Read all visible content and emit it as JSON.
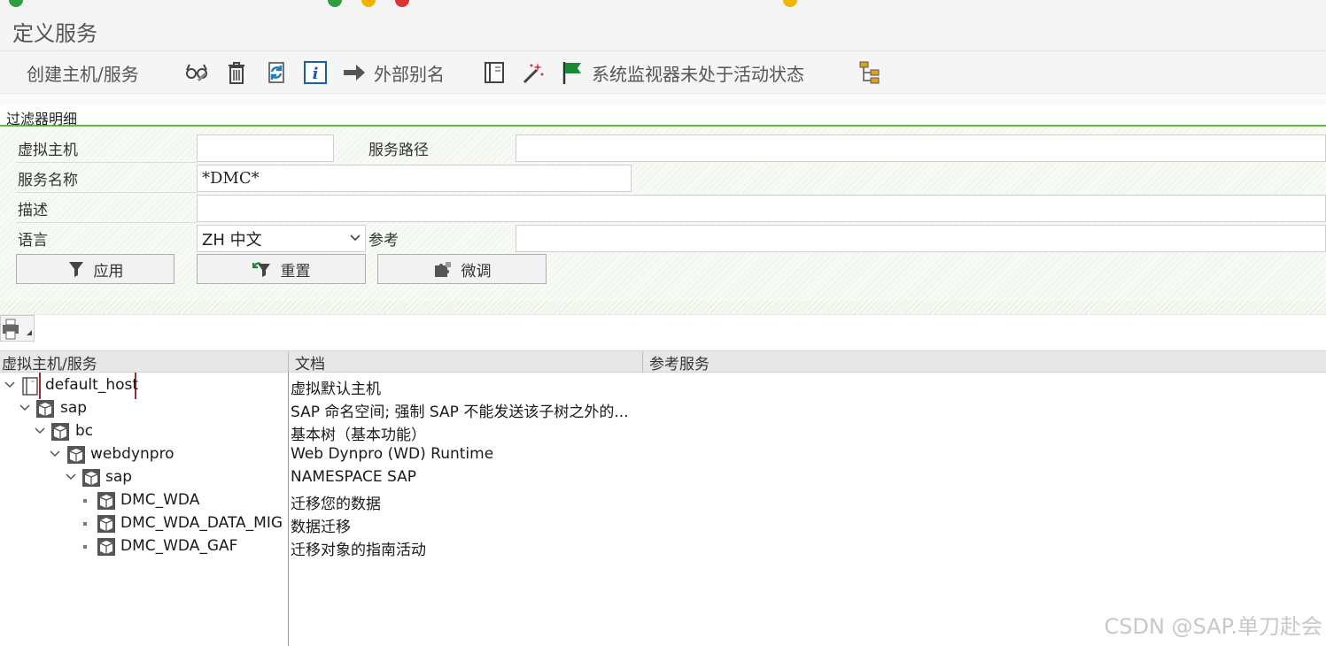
{
  "window": {
    "title": "定义服务"
  },
  "toolbar": {
    "create_label": "创建主机/服务",
    "alias_label": "外部别名",
    "monitor_label": "系统监视器未处于活动状态"
  },
  "filter": {
    "section_title": "过滤器明细",
    "virtual_host_label": "虚拟主机",
    "virtual_host_value": "",
    "service_path_label": "服务路径",
    "service_path_value": "",
    "service_name_label": "服务名称",
    "service_name_value": "*DMC*",
    "description_label": "描述",
    "description_value": "",
    "language_label": "语言",
    "language_value": "ZH 中文",
    "reference_label": "参考",
    "reference_value": "",
    "apply_label": "应用",
    "reset_label": "重置",
    "finetune_label": "微调"
  },
  "grid": {
    "col_service": "虚拟主机/服务",
    "col_document": "文档",
    "col_reference": "参考服务"
  },
  "tree": [
    {
      "name": "default_host",
      "doc": "虚拟默认主机"
    },
    {
      "name": "sap",
      "doc": "SAP 命名空间; 强制 SAP 不能发送该子树之外的..."
    },
    {
      "name": "bc",
      "doc": "基本树（基本功能）"
    },
    {
      "name": "webdynpro",
      "doc": "Web Dynpro (WD) Runtime"
    },
    {
      "name": "sap",
      "doc": "NAMESPACE SAP"
    },
    {
      "name": "DMC_WDA",
      "doc": "迁移您的数据"
    },
    {
      "name": "DMC_WDA_DATA_MIG",
      "doc": "数据迁移"
    },
    {
      "name": "DMC_WDA_GAF",
      "doc": "迁移对象的指南活动"
    }
  ],
  "watermark": "CSDN @SAP.单刀赴会",
  "colors": {
    "accent_green": "#55c130",
    "flag_green": "#1a8a3a",
    "focus": "#a52a2a"
  }
}
